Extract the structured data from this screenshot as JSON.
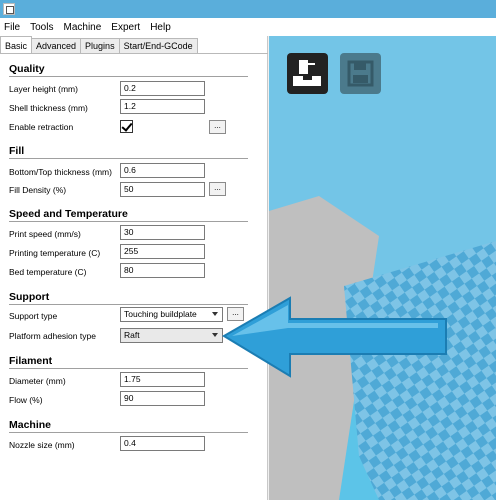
{
  "menu": [
    "File",
    "Tools",
    "Machine",
    "Expert",
    "Help"
  ],
  "tabs": [
    "Basic",
    "Advanced",
    "Plugins",
    "Start/End-GCode"
  ],
  "sections": {
    "quality": "Quality",
    "fill": "Fill",
    "speed": "Speed and Temperature",
    "support": "Support",
    "filament": "Filament",
    "machine": "Machine"
  },
  "fields": {
    "layer_height": {
      "label": "Layer height (mm)",
      "value": "0.2"
    },
    "shell_thickness": {
      "label": "Shell thickness (mm)",
      "value": "1.2"
    },
    "enable_retraction": {
      "label": "Enable retraction",
      "checked": true
    },
    "bottom_top_thickness": {
      "label": "Bottom/Top thickness (mm)",
      "value": "0.6"
    },
    "fill_density": {
      "label": "Fill Density (%)",
      "value": "50"
    },
    "print_speed": {
      "label": "Print speed (mm/s)",
      "value": "30"
    },
    "printing_temperature": {
      "label": "Printing temperature (C)",
      "value": "255"
    },
    "bed_temperature": {
      "label": "Bed temperature (C)",
      "value": "80"
    },
    "support_type": {
      "label": "Support type",
      "value": "Touching buildplate"
    },
    "platform_adhesion": {
      "label": "Platform adhesion type",
      "value": "Raft"
    },
    "diameter": {
      "label": "Diameter (mm)",
      "value": "1.75"
    },
    "flow": {
      "label": "Flow (%)",
      "value": "90"
    },
    "nozzle_size": {
      "label": "Nozzle size (mm)",
      "value": "0.4"
    }
  },
  "more_button": "...",
  "icons": {
    "load": "load-model-icon",
    "save": "save-icon",
    "annotation": "arrow-pointer-icon"
  },
  "colors": {
    "titlebar": "#5aaedb",
    "viewport": "#5cc4e8",
    "arrow": "#2f9fd8"
  }
}
